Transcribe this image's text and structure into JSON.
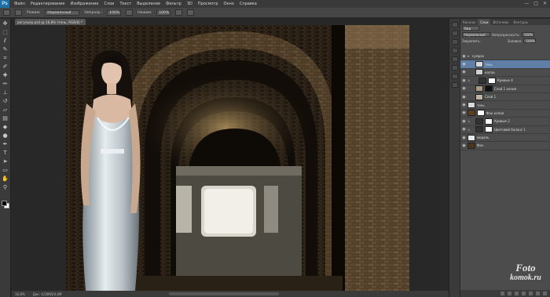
{
  "app": {
    "logo": "Ps"
  },
  "menu": [
    "Файл",
    "Редактирование",
    "Изображение",
    "Слои",
    "Текст",
    "Выделение",
    "Фильтр",
    "3D",
    "Просмотр",
    "Окно",
    "Справка"
  ],
  "window_controls": [
    "—",
    "□",
    "✕"
  ],
  "options": {
    "mode_label": "Режим:",
    "mode_value": "Нормальный",
    "opacity_label": "Непрозр.:",
    "opacity_value": "100%",
    "pressure_label": "Нажим:",
    "pressure_value": "100%"
  },
  "document": {
    "tab_title": "регульяр.psd @ 16,8% (тень, RGB/8) *"
  },
  "status": {
    "zoom": "16,8%",
    "doc_size": "Док: 4,50М/20,4М"
  },
  "panels": {
    "tabs": [
      "Каналы",
      "Слои",
      "Источник",
      "Контуры"
    ],
    "kind_value": "Вид",
    "blend_value": "Нормальный",
    "opacity_label": "Непрозрачность:",
    "opacity_value": "100%",
    "lock_label": "Закрепить:",
    "fill_label": "Заливка:",
    "fill_value": "100%",
    "layers": [
      {
        "name": "сумрак",
        "kind": "group"
      },
      {
        "name": "тень",
        "kind": "layer",
        "selected": true
      },
      {
        "name": "капли",
        "kind": "layer"
      },
      {
        "name": "Кривые 4",
        "kind": "adjust"
      },
      {
        "name": "Слой 1 копия",
        "kind": "masked"
      },
      {
        "name": "Слой 1",
        "kind": "layer"
      },
      {
        "name": "тень",
        "kind": "layer"
      },
      {
        "name": "Фон копия",
        "kind": "masked"
      },
      {
        "name": "Кривые 2",
        "kind": "adjust"
      },
      {
        "name": "Цветовой баланс 1",
        "kind": "adjust"
      },
      {
        "name": "модель",
        "kind": "layer"
      },
      {
        "name": "Фон",
        "kind": "layer"
      }
    ]
  },
  "watermark": {
    "line1": "Foto",
    "line2": "komok.ru"
  }
}
